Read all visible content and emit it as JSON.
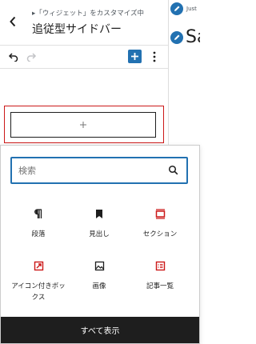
{
  "header": {
    "breadcrumb": "▸「ウィジェット」をカスタマイズ中",
    "title": "追従型サイドバー"
  },
  "inserter": {
    "search_placeholder": "検索",
    "blocks": [
      {
        "label": "段落",
        "icon": "paragraph-icon"
      },
      {
        "label": "見出し",
        "icon": "heading-bookmark-icon"
      },
      {
        "label": "セクション",
        "icon": "section-icon"
      },
      {
        "label": "アイコン付きボックス",
        "icon": "icon-box-icon"
      },
      {
        "label": "画像",
        "icon": "image-icon"
      },
      {
        "label": "記事一覧",
        "icon": "post-list-icon"
      }
    ],
    "show_all": "すべて表示"
  },
  "preview": {
    "tagline": "Just",
    "site_title": "Sa"
  },
  "colors": {
    "accent": "#2271b1",
    "highlight": "#cc1818",
    "dark": "#1e1e1e"
  }
}
